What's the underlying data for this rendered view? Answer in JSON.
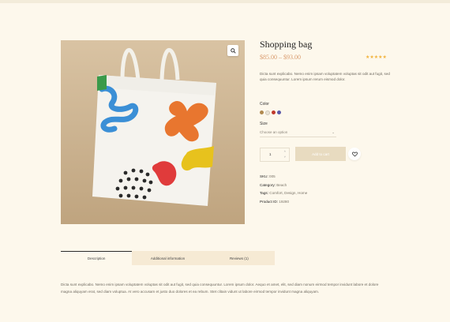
{
  "product": {
    "title": "Shopping bag",
    "price": "$85.00 – $93.00",
    "stars": "★★★★★",
    "short_description": "Dicta sunt explicabo. Nemo enim ipsam voluptatem voluptas sit odit aut fugit, sed quia consequuntur. Lorem ipsum rerum eismod dolor.",
    "color_label": "Color",
    "colors": [
      "#b0894f",
      "#e9e3d6",
      "#c0392b",
      "#5a58a8"
    ],
    "size_label": "Size",
    "size_placeholder": "Choose an option",
    "quantity": "1",
    "add_to_cart_label": "Add to cart",
    "meta": {
      "sku_key": "SKU:",
      "sku": "005",
      "category_key": "Category:",
      "category": "Beach",
      "tags_key": "Tags:",
      "tags": "Comfort, Design, Home",
      "product_id_key": "Product ID:",
      "product_id": "19280"
    }
  },
  "tabs": [
    {
      "label": "Description"
    },
    {
      "label": "Additional information"
    },
    {
      "label": "Reviews (1)"
    }
  ],
  "description": "Dicta sunt explicabo. Nemo enim ipsam voluptatem voluptas sit odit aut fugit, sed quia consequuntur. Lorem ipsum dolor. Aequo et amet, elit, sed diam nonum eirmod tempor invidunt labore et dolore magna aliquyam erat, sed diam voluptua. At vero accusam et justo duo dolores et ea rebum. Stet clitain vidunt ut labore eirmod tempor invidunt magna aliquyam.",
  "icons": {
    "zoom": "search-icon",
    "wishlist": "heart-icon",
    "size_dropdown": "chevron-down-icon"
  }
}
